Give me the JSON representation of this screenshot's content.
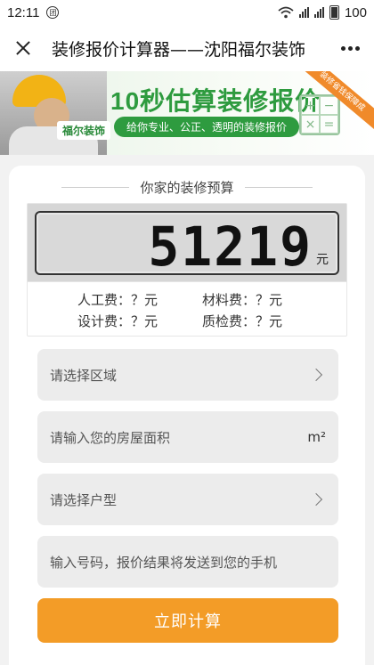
{
  "status_bar": {
    "time": "12:11",
    "notification_glyph": "团",
    "network_1": "3G",
    "network_2": "3G",
    "battery": "100"
  },
  "nav": {
    "title": "装修报价计算器——沈阳福尔装饰",
    "close_icon": "close-icon",
    "more_icon": "more-icon"
  },
  "banner": {
    "brand": "福尔装饰",
    "headline_num": "10",
    "headline_text": "秒估算装修报价",
    "subtitle": "给你专业、公正、透明的装修报价",
    "ribbon": "装修省钱保障成"
  },
  "calculator": {
    "section_title": "你家的装修预算",
    "total": "51219",
    "unit": "元",
    "fees": [
      {
        "label": "人工费：？元"
      },
      {
        "label": "材料费：？元"
      },
      {
        "label": "设计费：？元"
      },
      {
        "label": "质检费：？元"
      }
    ]
  },
  "form": {
    "region_placeholder": "请选择区域",
    "area_placeholder": "请输入您的房屋面积",
    "area_unit": "m²",
    "layout_placeholder": "请选择户型",
    "phone_placeholder": "输入号码，报价结果将发送到您的手机",
    "submit_label": "立即计算"
  },
  "colors": {
    "accent": "#f39c27",
    "brand_green": "#2e9b3f"
  }
}
